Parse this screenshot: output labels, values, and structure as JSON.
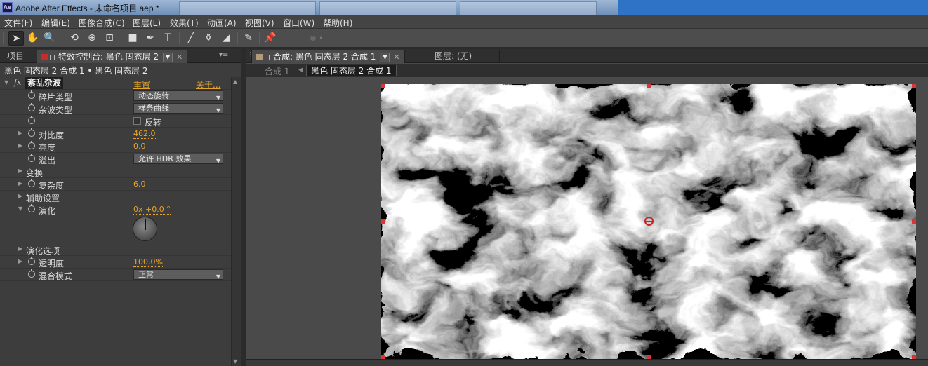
{
  "window": {
    "app_icon": "Ae",
    "title": "Adobe After Effects - 未命名项目.aep *"
  },
  "menu": {
    "items": [
      "文件(F)",
      "编辑(E)",
      "图像合成(C)",
      "图层(L)",
      "效果(T)",
      "动画(A)",
      "视图(V)",
      "窗口(W)",
      "帮助(H)"
    ]
  },
  "toolbar": {
    "tools": [
      {
        "name": "selection-tool",
        "glyph": "➤"
      },
      {
        "name": "hand-tool",
        "glyph": "✋"
      },
      {
        "name": "zoom-tool",
        "glyph": "🔍"
      },
      {
        "name": "rotate-tool",
        "glyph": "⟲"
      },
      {
        "name": "camera-tool",
        "glyph": "⊕"
      },
      {
        "name": "pan-behind-tool",
        "glyph": "⊡"
      },
      {
        "name": "rectangle-tool",
        "glyph": "■"
      },
      {
        "name": "pen-tool",
        "glyph": "✒"
      },
      {
        "name": "type-tool",
        "glyph": "T"
      },
      {
        "name": "brush-tool",
        "glyph": "╱"
      },
      {
        "name": "clone-stamp-tool",
        "glyph": "⚱"
      },
      {
        "name": "eraser-tool",
        "glyph": "◢"
      },
      {
        "name": "roto-brush-tool",
        "glyph": "✎"
      },
      {
        "name": "puppet-pin-tool",
        "glyph": "📌"
      }
    ]
  },
  "left_panel": {
    "tab_project": "项目",
    "tab_effects": "特效控制台: 黑色 固态层 2",
    "layer_path": "黑色 固态层 2 合成 1 • 黑色 固态层 2",
    "effect": {
      "fx": "fx",
      "name": "紊乱杂波",
      "reset": "重置",
      "about": "关于..."
    },
    "properties": {
      "fractal_type": {
        "label": "碎片类型",
        "value": "动态旋转"
      },
      "noise_type": {
        "label": "杂波类型",
        "value": "样条曲线"
      },
      "invert": {
        "label": "反转"
      },
      "contrast": {
        "label": "对比度",
        "value": "462.0"
      },
      "brightness": {
        "label": "亮度",
        "value": "0.0"
      },
      "overflow": {
        "label": "溢出",
        "value": "允许 HDR 效果"
      },
      "transform": {
        "label": "变换"
      },
      "complexity": {
        "label": "复杂度",
        "value": "6.0"
      },
      "sub_settings": {
        "label": "辅助设置"
      },
      "evolution": {
        "label": "演化",
        "value": "0x +0.0 °"
      },
      "evolution_options": {
        "label": "演化选项"
      },
      "opacity": {
        "label": "透明度",
        "value": "100.0%"
      },
      "blend_mode": {
        "label": "混合模式",
        "value": "正常"
      }
    }
  },
  "right_panel": {
    "tab_comp": "合成: 黑色 固态层 2 合成 1",
    "tab_layer": "图层: (无)",
    "breadcrumb_prev": "合成 1",
    "breadcrumb_current": "黑色 固态层 2 合成 1"
  },
  "colors": {
    "accent_value": "#e8a329",
    "handle": "#d33333",
    "anchor": "#c62222"
  }
}
